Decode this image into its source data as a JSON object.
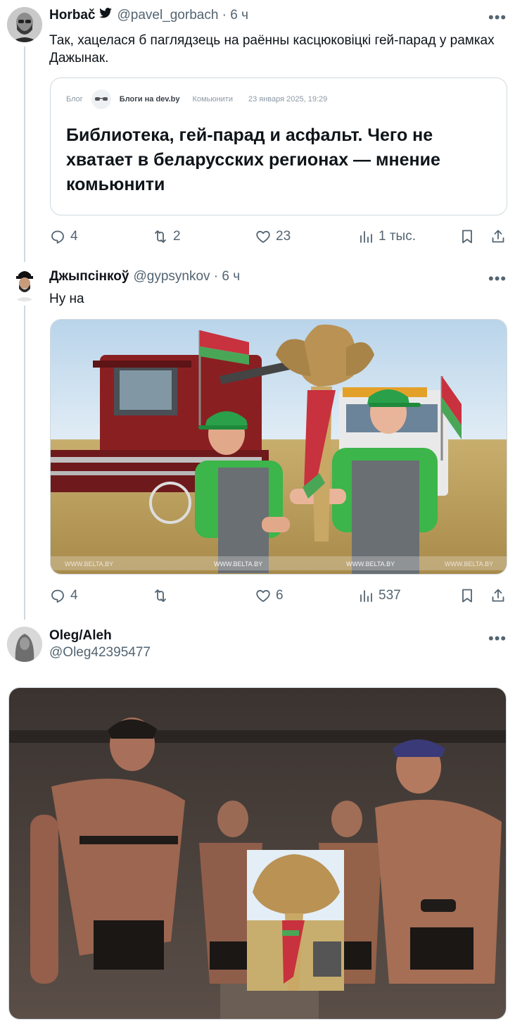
{
  "tweets": [
    {
      "name": "Horbač",
      "handle": "@pavel_gorbach · 6 ч",
      "text": "Так, хацелася б паглядзець на раённы касцюковіцкі гей-парад у рамках Дажынак.",
      "card": {
        "section": "Блог",
        "source": "Блоги на dev.by",
        "category": "Комьюнити",
        "date": "23 января 2025, 19:29",
        "title": "Библиотека, гей-парад и асфальт. Чего не хватает в беларусских регионах — мнение комьюнити"
      },
      "stats": {
        "replies": "4",
        "retweets": "2",
        "likes": "23",
        "views": "1 тыс."
      }
    },
    {
      "name": "Джыпсінкоў",
      "handle": "@gypsynkov · 6 ч",
      "text": "Ну на",
      "image": {
        "watermark": "WWW.BELTA.BY"
      },
      "stats": {
        "replies": "4",
        "retweets": "",
        "likes": "6",
        "views": "537"
      }
    },
    {
      "name": "Oleg/Aleh",
      "handle": "@Oleg42395477"
    }
  ],
  "icons": {
    "verified": "bird-icon",
    "more": "more-icon",
    "reply": "reply-icon",
    "retweet": "retweet-icon",
    "like": "heart-icon",
    "views": "views-icon",
    "bookmark": "bookmark-icon",
    "share": "share-icon"
  },
  "colors": {
    "text": "#0f1419",
    "secondary": "#536471",
    "border": "#cfd9de",
    "flag_red": "#c8313e",
    "flag_green": "#4aa657",
    "shirt_green": "#3cb54a"
  }
}
